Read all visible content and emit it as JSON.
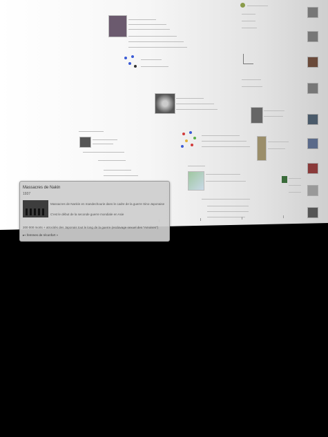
{
  "timeline": {
    "type": "perspective-timeline-wall",
    "accent_colors": [
      "#3b5bd6",
      "#d23b3b",
      "#5db04a",
      "#e0b23a"
    ]
  },
  "popup": {
    "title": "Massacres de Nakin",
    "year": "1937",
    "desc1": "Massacres de Nankin en mandechourie dans le cadre de la guerre Sino-Japonaise",
    "desc2": "C'est le début de la seconde guerre mondiale en Asie",
    "desc3": "200 000 morts + atrocités des Japonais tout le long de la guerre (esclavage sexuel des \"Amoises\")",
    "source_link": "« femmes de réconfort »"
  }
}
